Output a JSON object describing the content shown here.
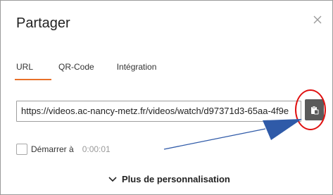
{
  "dialog": {
    "title": "Partager"
  },
  "tabs": [
    {
      "label": "URL",
      "active": true
    },
    {
      "label": "QR-Code",
      "active": false
    },
    {
      "label": "Intégration",
      "active": false
    }
  ],
  "url_field": {
    "value": "https://videos.ac-nancy-metz.fr/videos/watch/d97371d3-65aa-4f9e"
  },
  "copy_button": {
    "icon": "clipboard-copy-icon"
  },
  "start_option": {
    "label": "Démarrer à",
    "time_value": "0:00:01",
    "checked": false
  },
  "more_options": {
    "label": "Plus de personnalisation",
    "icon": "chevron-down-icon"
  },
  "annotation": {
    "highlight_color": "#e01010",
    "arrow_color": "#2f5aa8"
  },
  "colors": {
    "accent": "#e8702a",
    "copy_button_bg": "#5a5a5a"
  }
}
